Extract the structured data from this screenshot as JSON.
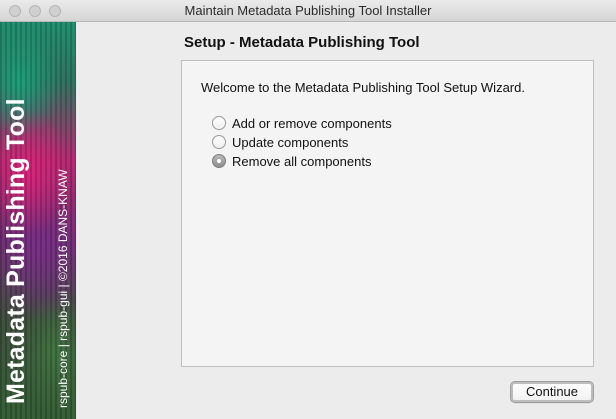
{
  "window": {
    "title": "Maintain Metadata Publishing Tool Installer"
  },
  "banner": {
    "main_text": "Metadata Publishing Tool",
    "sub_text": "rspub-core | rspub-gui | ©2016 DANS-KNAW"
  },
  "wizard": {
    "page_title": "Setup - Metadata Publishing Tool",
    "welcome_text": "Welcome to the Metadata Publishing Tool Setup Wizard.",
    "options": [
      {
        "label": "Add or remove components",
        "selected": false
      },
      {
        "label": "Update components",
        "selected": false
      },
      {
        "label": "Remove all components",
        "selected": true
      }
    ],
    "continue_label": "Continue"
  }
}
